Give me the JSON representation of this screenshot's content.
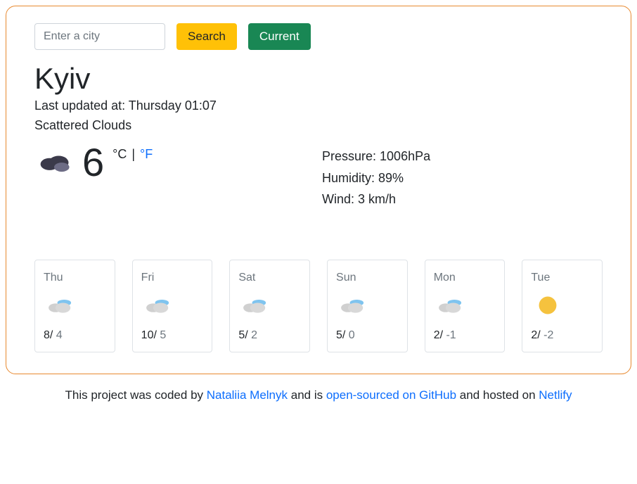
{
  "search": {
    "placeholder": "Enter a city",
    "search_label": "Search",
    "current_label": "Current"
  },
  "city": "Kyiv",
  "last_updated_prefix": "Last updated at: ",
  "last_updated": "Thursday 01:07",
  "condition": "Scattered Clouds",
  "current": {
    "temp": "6",
    "unit_c": "°C",
    "unit_sep": " | ",
    "unit_f": "°F",
    "pressure_label": "Pressure: ",
    "pressure": "1006hPa",
    "humidity_label": "Humidity: ",
    "humidity": "89%",
    "wind_label": "Wind: ",
    "wind": "3 km/h",
    "icon": "dark-cloud"
  },
  "forecast": [
    {
      "day": "Thu",
      "max": "8",
      "min": "4",
      "icon": "partly-cloudy"
    },
    {
      "day": "Fri",
      "max": "10",
      "min": "5",
      "icon": "partly-cloudy"
    },
    {
      "day": "Sat",
      "max": "5",
      "min": "2",
      "icon": "partly-cloudy"
    },
    {
      "day": "Sun",
      "max": "5",
      "min": "0",
      "icon": "partly-cloudy"
    },
    {
      "day": "Mon",
      "max": "2",
      "min": "-1",
      "icon": "partly-cloudy"
    },
    {
      "day": "Tue",
      "max": "2",
      "min": "-2",
      "icon": "sunny"
    }
  ],
  "footer": {
    "t1": "This project was coded by ",
    "author": "Nataliia Melnyk",
    "t2": " and is ",
    "link1": "open-sourced on GitHub",
    "t3": " and hosted on ",
    "link2": "Netlify"
  }
}
